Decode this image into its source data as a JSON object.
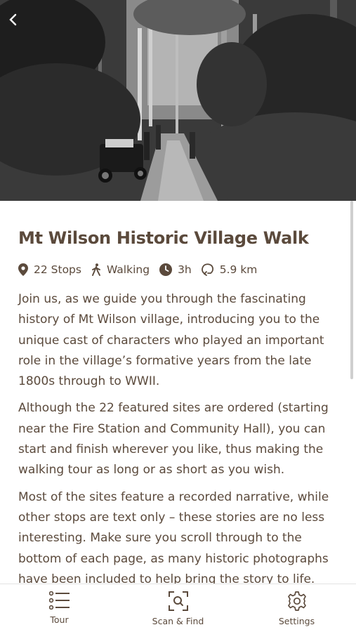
{
  "walk": {
    "title": "Mt Wilson Historic Village Walk",
    "stops": "22 Stops",
    "mode": "Walking",
    "duration": "3h",
    "distance": "5.9 km"
  },
  "description": [
    "Join us, as we guide you through the fascinating history of Mt Wilson village, introducing you to the unique cast of characters who played an important role in the village’s formative years from the late 1800s through to WWII.",
    "Although the 22 featured sites are ordered (starting near the Fire Station and Community Hall), you can start and finish wherever you like, thus making the walking tour as long or as short as you wish.",
    "Most of the sites feature a recorded narrative, while other stops are text only – these stories are no less interesting. Make sure you scroll through to the bottom of each page, as many historic photographs have been included to help bring the story to life."
  ],
  "tabs": [
    {
      "label": "Tour",
      "icon": "list-icon"
    },
    {
      "label": "Scan & Find",
      "icon": "scan-icon"
    },
    {
      "label": "Settings",
      "icon": "gear-icon"
    }
  ],
  "colors": {
    "text": "#5b4a3c",
    "divider": "#e3e3e3"
  }
}
